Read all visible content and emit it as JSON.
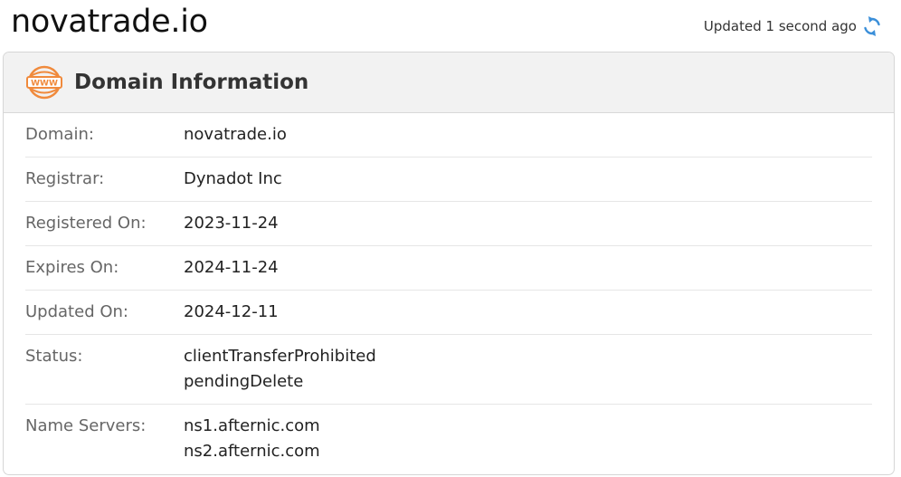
{
  "header": {
    "site_title": "novatrade.io",
    "updated_text": "Updated 1 second ago"
  },
  "card": {
    "title": "Domain Information",
    "icon": "www-icon",
    "rows": [
      {
        "label": "Domain:",
        "values": [
          "novatrade.io"
        ]
      },
      {
        "label": "Registrar:",
        "values": [
          "Dynadot Inc"
        ]
      },
      {
        "label": "Registered On:",
        "values": [
          "2023-11-24"
        ]
      },
      {
        "label": "Expires On:",
        "values": [
          "2024-11-24"
        ]
      },
      {
        "label": "Updated On:",
        "values": [
          "2024-12-11"
        ]
      },
      {
        "label": "Status:",
        "values": [
          "clientTransferProhibited",
          "pendingDelete"
        ]
      },
      {
        "label": "Name Servers:",
        "values": [
          "ns1.afternic.com",
          "ns2.afternic.com"
        ]
      }
    ]
  },
  "colors": {
    "accent_orange": "#f08a3c",
    "refresh_blue": "#3b8fd9",
    "header_bg": "#f2f2f2"
  }
}
